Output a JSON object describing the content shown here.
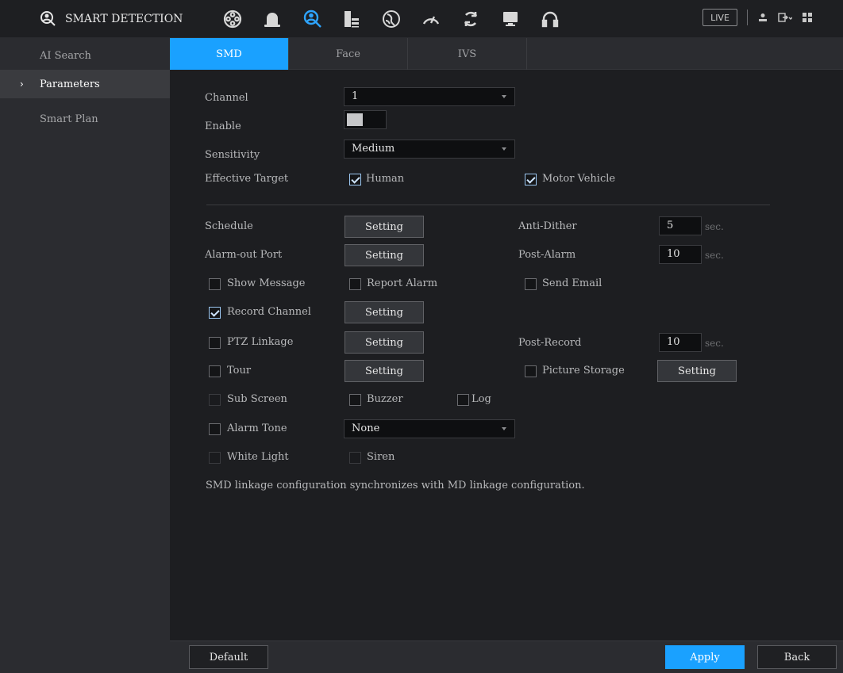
{
  "header": {
    "title": "SMART DETECTION",
    "logo_icon": "smart-detection-icon",
    "nav_icons": [
      "film-reel-icon",
      "alarm-bell-icon",
      "smart-detection-icon",
      "storage-icon",
      "network-icon",
      "gauge-icon",
      "sync-icon",
      "monitor-icon",
      "headset-icon"
    ],
    "active_nav": "smart-detection-icon",
    "accent_color": "#2ea4ff",
    "live_label": "LIVE",
    "right_icons": [
      "user-icon",
      "logout-icon",
      "grid-icon"
    ]
  },
  "sidebar": {
    "header_label": "AI Search",
    "items": [
      {
        "label": "Parameters",
        "active": true
      },
      {
        "label": "Smart Plan",
        "active": false
      }
    ]
  },
  "tabs": [
    {
      "label": "SMD",
      "active": true
    },
    {
      "label": "Face",
      "active": false
    },
    {
      "label": "IVS",
      "active": false
    }
  ],
  "form": {
    "channel": {
      "label": "Channel",
      "value": "1"
    },
    "enable": {
      "label": "Enable",
      "on": false
    },
    "sensitivity": {
      "label": "Sensitivity",
      "value": "Medium"
    },
    "effective_target": {
      "label": "Effective Target",
      "human": {
        "label": "Human",
        "checked": true
      },
      "motor_vehicle": {
        "label": "Motor Vehicle",
        "checked": true
      }
    },
    "schedule": {
      "label": "Schedule",
      "button": "Setting"
    },
    "anti_dither": {
      "label": "Anti-Dither",
      "value": "5",
      "unit": "sec."
    },
    "alarm_out_port": {
      "label": "Alarm-out Port",
      "button": "Setting"
    },
    "post_alarm": {
      "label": "Post-Alarm",
      "value": "10",
      "unit": "sec."
    },
    "show_message": {
      "label": "Show Message",
      "checked": false
    },
    "report_alarm": {
      "label": "Report Alarm",
      "checked": false
    },
    "send_email": {
      "label": "Send Email",
      "checked": false
    },
    "record_channel": {
      "label": "Record Channel",
      "checked": true,
      "button": "Setting"
    },
    "ptz_linkage": {
      "label": "PTZ Linkage",
      "checked": false,
      "button": "Setting"
    },
    "post_record": {
      "label": "Post-Record",
      "value": "10",
      "unit": "sec."
    },
    "tour": {
      "label": "Tour",
      "checked": false,
      "button": "Setting"
    },
    "picture_storage": {
      "label": "Picture Storage",
      "checked": false,
      "button": "Setting"
    },
    "sub_screen": {
      "label": "Sub Screen",
      "checked": false
    },
    "buzzer": {
      "label": "Buzzer",
      "checked": false
    },
    "log": {
      "label": "Log",
      "checked": false
    },
    "alarm_tone": {
      "label": "Alarm Tone",
      "checked": false,
      "value": "None"
    },
    "white_light": {
      "label": "White Light",
      "checked": false
    },
    "siren": {
      "label": "Siren",
      "checked": false
    }
  },
  "note": "SMD linkage configuration synchronizes with MD linkage configuration.",
  "footer": {
    "default_label": "Default",
    "apply_label": "Apply",
    "back_label": "Back"
  }
}
